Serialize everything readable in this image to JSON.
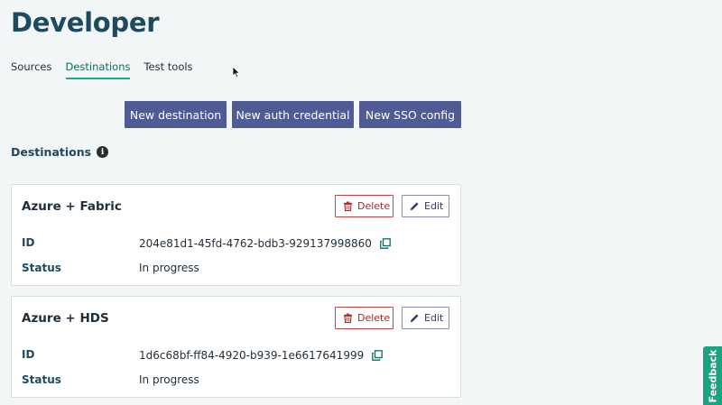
{
  "header": {
    "title": "Developer"
  },
  "tabs": [
    {
      "label": "Sources"
    },
    {
      "label": "Destinations",
      "active": true
    },
    {
      "label": "Test tools"
    }
  ],
  "actions": {
    "new_destination": "New destination",
    "new_auth_credential": "New auth credential",
    "new_sso_config": "New SSO config"
  },
  "section": {
    "title": "Destinations",
    "info_icon": "info-icon"
  },
  "destinations": [
    {
      "name": "Azure + Fabric",
      "id_label": "ID",
      "id_value": "204e81d1-45fd-4762-bdb3-929137998860",
      "status_label": "Status",
      "status_value": "In progress",
      "delete_label": "Delete",
      "edit_label": "Edit"
    },
    {
      "name": "Azure + HDS",
      "id_label": "ID",
      "id_value": "1d6c68bf-ff84-4920-b939-1e6617641999",
      "status_label": "Status",
      "status_value": "In progress",
      "delete_label": "Delete",
      "edit_label": "Edit"
    }
  ],
  "feedback": {
    "label": "Feedback"
  },
  "colors": {
    "primary_button": "#4f5b95",
    "tab_active_underline": "#1aaa8a",
    "title": "#1c4a5e",
    "delete": "#9b2c2c",
    "feedback": "#1aa37f",
    "copy_icon": "#0f6b68"
  }
}
